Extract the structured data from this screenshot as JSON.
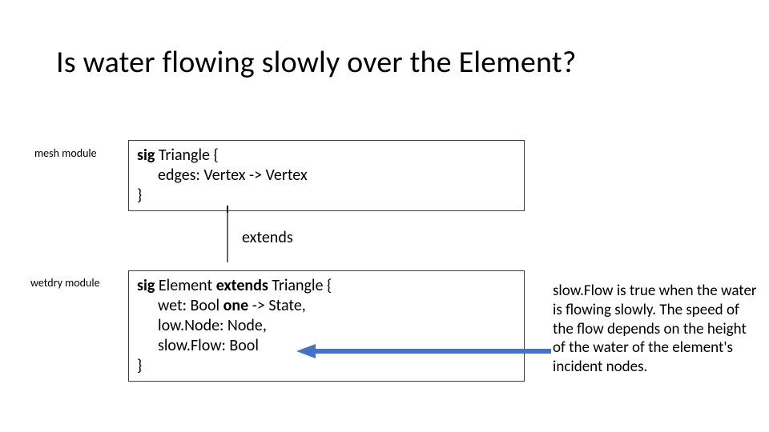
{
  "title": "Is water flowing slowly over the Element?",
  "labels": {
    "mesh": "mesh module",
    "wetdry": "wetdry module",
    "extends": "extends"
  },
  "box1": {
    "kw_sig": "sig",
    "line1_rest": " Triangle {",
    "line2": "edges: Vertex -> Vertex",
    "line3": "}"
  },
  "box2": {
    "kw_sig": "sig",
    "l1_a": " Element ",
    "kw_extends": "extends",
    "l1_b": " Triangle {",
    "l2_a": "wet: Bool ",
    "kw_one": "one",
    "l2_b": " -> State,",
    "l3": "low.Node: Node,",
    "l4": "slow.Flow: Bool",
    "l5": "}"
  },
  "annotation": "slow.Flow is true when the water is flowing slowly. The speed of the flow depends on the height of the water of the element's incident nodes.",
  "colors": {
    "blue": "#4472C4"
  }
}
